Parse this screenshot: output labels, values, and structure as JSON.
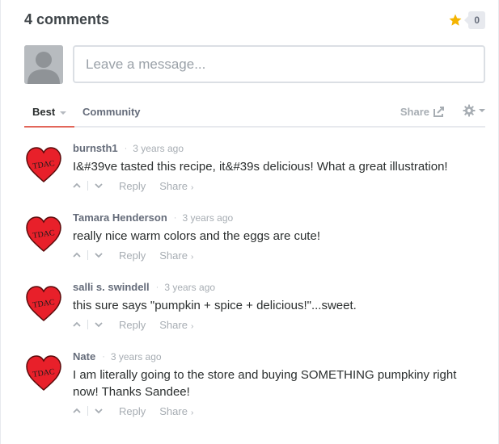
{
  "header": {
    "comment_count": "4 comments",
    "recommend_count": "0",
    "star_color": "#f4b400",
    "star_icon": "star-icon"
  },
  "compose": {
    "placeholder": "Leave a message..."
  },
  "nav": {
    "tab_best": "Best",
    "tab_community": "Community",
    "share_label": "Share",
    "accent_color": "#e2665a"
  },
  "comments": [
    {
      "author": "burnsth1",
      "time": "3 years ago",
      "text": "I&#39ve tasted this recipe, it&#39s delicious! What a great illustration!",
      "reply": "Reply",
      "share": "Share"
    },
    {
      "author": "Tamara Henderson",
      "time": "3 years ago",
      "text": "really nice warm colors and the eggs are cute!",
      "reply": "Reply",
      "share": "Share"
    },
    {
      "author": "salli s. swindell",
      "time": "3 years ago",
      "text": "this sure says \"pumpkin + spice + delicious!\"...sweet.",
      "reply": "Reply",
      "share": "Share"
    },
    {
      "author": "Nate",
      "time": "3 years ago",
      "text": "I am literally going to the store and buying SOMETHING pumpkiny right now! Thanks Sandee!",
      "reply": "Reply",
      "share": "Share"
    }
  ],
  "avatar_logo_text": "TDAC"
}
